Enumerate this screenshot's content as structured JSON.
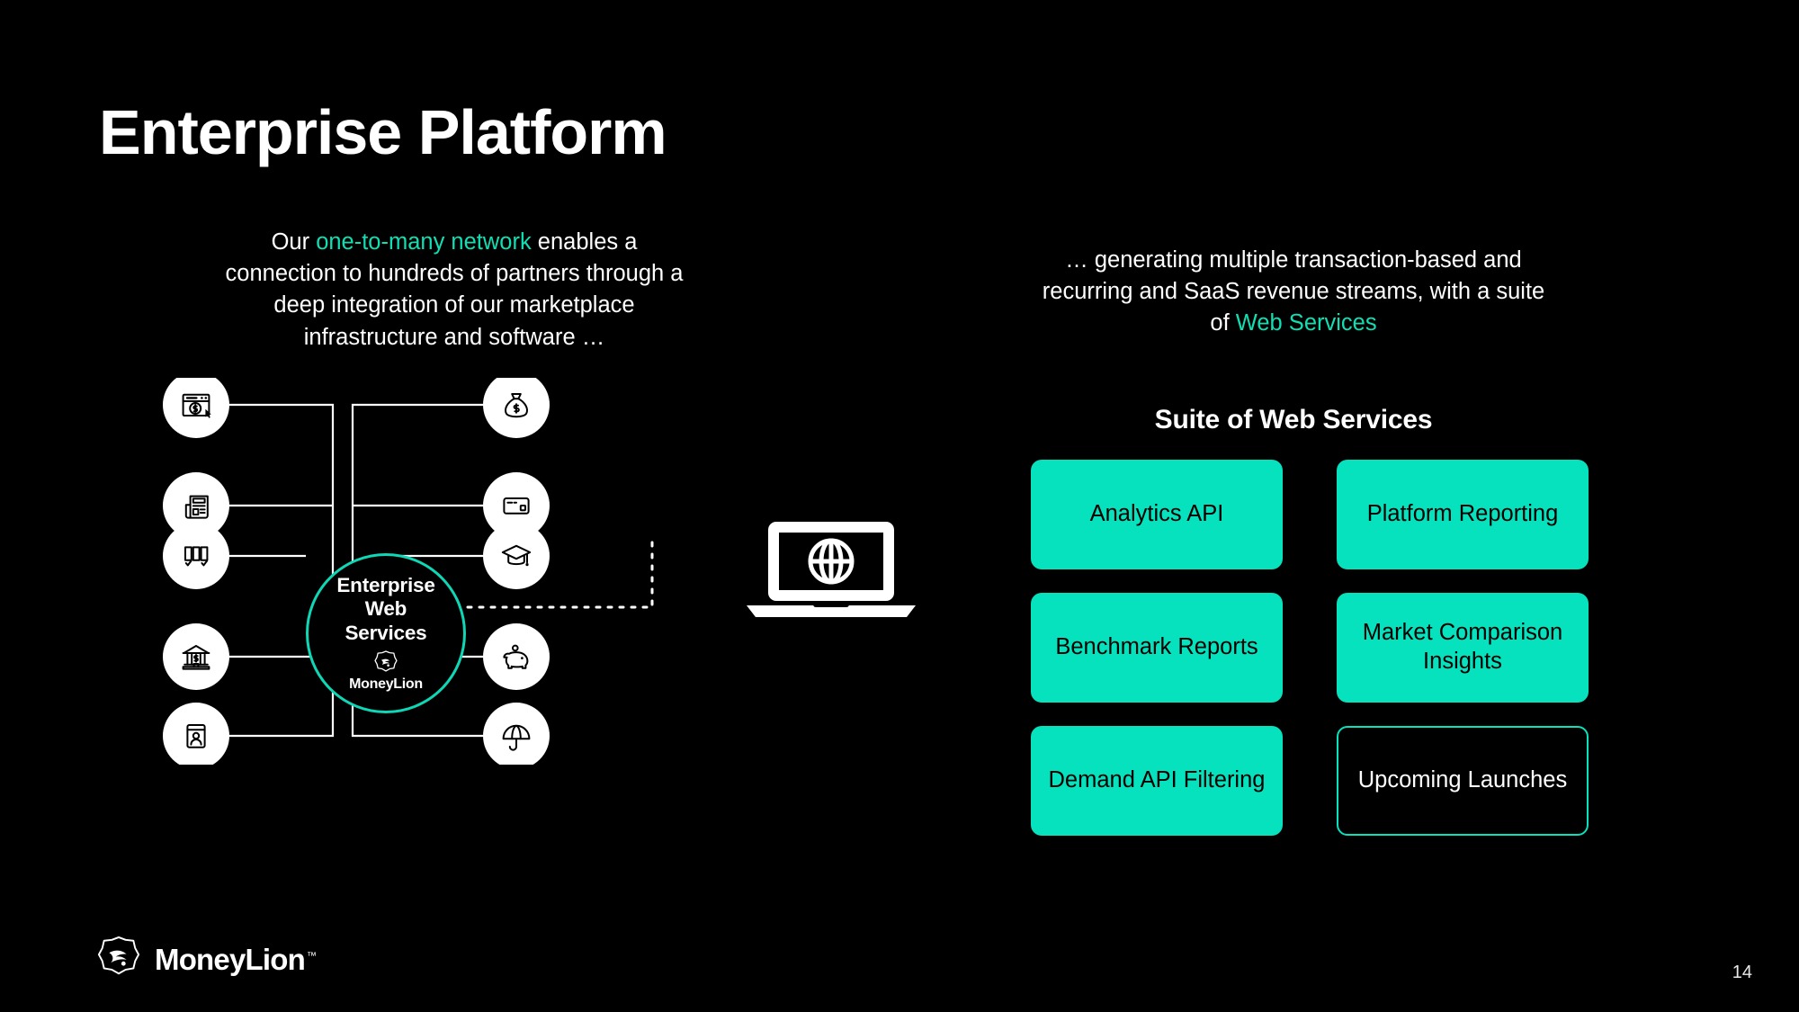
{
  "slide": {
    "title": "Enterprise Platform",
    "page_number": "14",
    "background_color": "#000000",
    "accent_color": "#06e2bd",
    "text_color": "#ffffff"
  },
  "left_column": {
    "paragraph": {
      "before_highlight": "Our ",
      "highlight": "one-to-many network",
      "after_highlight": " enables a connection to hundreds of partners through a deep integration of our marketplace infrastructure and software …"
    },
    "hub": {
      "label_line_1": "Enterprise",
      "label_line_2": "Web",
      "label_line_3": "Services",
      "brand": "MoneyLion",
      "logo_name": "moneylion-badge-icon"
    },
    "left_nodes": [
      {
        "icon": "browser-dollar-cursor-icon"
      },
      {
        "icon": "newspaper-document-icon"
      },
      {
        "icon": "compare-cards-checkmarks-icon"
      },
      {
        "icon": "bank-dollar-icon"
      },
      {
        "icon": "id-card-person-icon"
      }
    ],
    "right_nodes": [
      {
        "icon": "money-bag-icon"
      },
      {
        "icon": "credit-card-icon"
      },
      {
        "icon": "graduation-cap-icon"
      },
      {
        "icon": "piggy-bank-icon"
      },
      {
        "icon": "umbrella-icon"
      }
    ],
    "endpoint": {
      "icon": "laptop-globe-icon"
    }
  },
  "right_column": {
    "paragraph": {
      "before_highlight": "… generating multiple transaction-based and recurring and SaaS revenue streams, with a suite of ",
      "highlight": "Web Services",
      "after_highlight": ""
    },
    "suite_heading": "Suite of Web Services",
    "cards": [
      {
        "label": "Analytics API",
        "style": "filled"
      },
      {
        "label": "Platform Reporting",
        "style": "filled"
      },
      {
        "label": "Benchmark Reports",
        "style": "filled"
      },
      {
        "label": "Market Comparison Insights",
        "style": "filled"
      },
      {
        "label": "Demand API Filtering",
        "style": "filled"
      },
      {
        "label": "Upcoming Launches",
        "style": "outlined"
      }
    ]
  },
  "footer": {
    "brand": "MoneyLion",
    "trademark": "™",
    "logo_name": "moneylion-badge-icon"
  }
}
